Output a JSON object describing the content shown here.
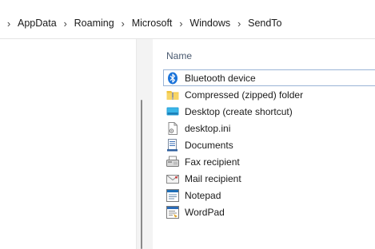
{
  "breadcrumb": {
    "items": [
      "AppData",
      "Roaming",
      "Microsoft",
      "Windows",
      "SendTo"
    ],
    "separator": "›"
  },
  "filepane": {
    "column_header": "Name",
    "files": [
      {
        "label": "Bluetooth device",
        "icon": "bluetooth-icon"
      },
      {
        "label": "Compressed (zipped) folder",
        "icon": "zip-folder-icon"
      },
      {
        "label": "Desktop (create shortcut)",
        "icon": "desktop-icon"
      },
      {
        "label": "desktop.ini",
        "icon": "ini-file-icon"
      },
      {
        "label": "Documents",
        "icon": "documents-icon"
      },
      {
        "label": "Fax recipient",
        "icon": "fax-icon"
      },
      {
        "label": "Mail recipient",
        "icon": "mail-icon"
      },
      {
        "label": "Notepad",
        "icon": "notepad-icon"
      },
      {
        "label": "WordPad",
        "icon": "wordpad-icon"
      }
    ]
  },
  "colors": {
    "accent": "#0067c0",
    "focus_border": "#9ab4d6",
    "header_text": "#4a5a70"
  }
}
